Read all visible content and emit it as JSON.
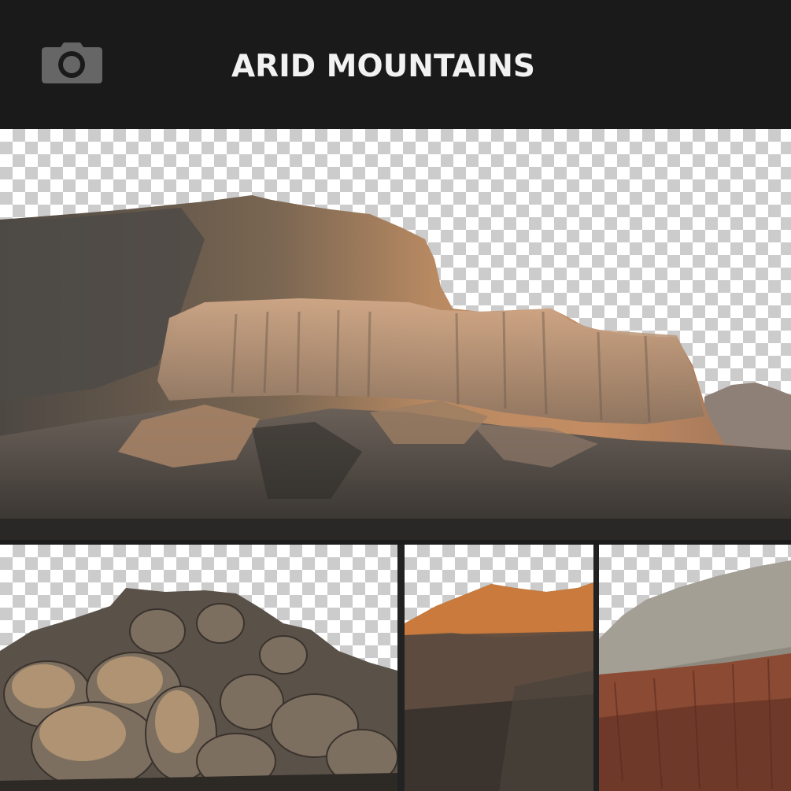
{
  "header": {
    "title": "ARID MOUNTAINS",
    "icon": "camera-icon",
    "background": "#1a1a1a",
    "icon_color": "#6a6a6a"
  },
  "panels": {
    "main": {
      "subject": "mesa-cliff-cutout",
      "accent": "#c8865a"
    },
    "bottom_left": {
      "subject": "boulder-pile-cutout",
      "accent": "#b99a72"
    },
    "bottom_middle": {
      "subject": "sunlit-peak-cutout",
      "accent": "#c9773a"
    },
    "bottom_right": {
      "subject": "red-rock-slope-cutout",
      "accent": "#a4583a"
    }
  }
}
